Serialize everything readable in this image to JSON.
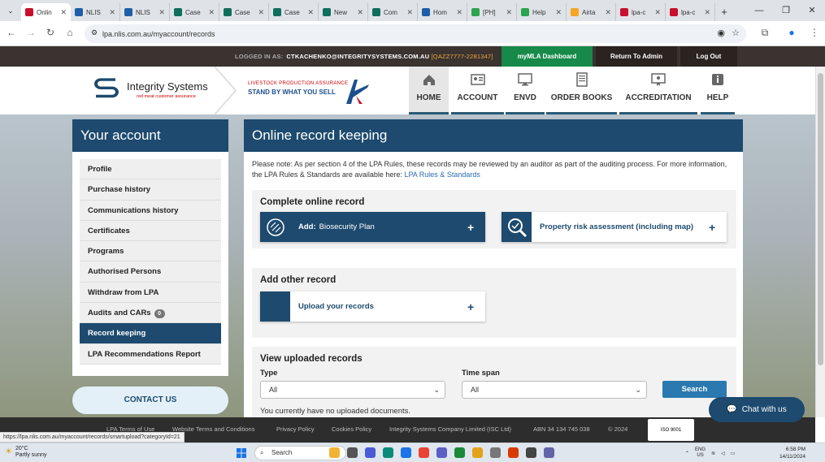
{
  "browser": {
    "tabs": [
      {
        "title": "Onlin",
        "color": "#c8102e",
        "active": true
      },
      {
        "title": "NLIS",
        "color": "#1f5fa8"
      },
      {
        "title": "NLIS",
        "color": "#1f5fa8"
      },
      {
        "title": "Case",
        "color": "#0f6f5c"
      },
      {
        "title": "Case",
        "color": "#0f6f5c"
      },
      {
        "title": "Case",
        "color": "#0f6f5c"
      },
      {
        "title": "New",
        "color": "#0f6f5c"
      },
      {
        "title": "Com",
        "color": "#0f6f5c"
      },
      {
        "title": "Hom",
        "color": "#1f5fa8"
      },
      {
        "title": "[PH]",
        "color": "#2da44e"
      },
      {
        "title": "Help",
        "color": "#2da44e"
      },
      {
        "title": "Airta",
        "color": "#f5a623"
      },
      {
        "title": "lpa-c",
        "color": "#c8102e"
      },
      {
        "title": "lpa-c",
        "color": "#c8102e"
      }
    ],
    "new_tab": "+",
    "url": "lpa.nlis.com.au/myaccount/records",
    "window_controls": [
      "—",
      "❐",
      "✕"
    ]
  },
  "topbar": {
    "logged_in_label": "LOGGED IN AS:",
    "user": "CTKACHENKO@INTEGRITYSYSTEMS.COM.AU",
    "account": "[QAZZ7777-2281347]",
    "mymla": "myMLA Dashboard",
    "return_admin": "Return To Admin",
    "logout": "Log Out",
    "mymla_color": "#178a4a"
  },
  "header": {
    "logo_name": "Integrity Systems",
    "logo_sub": "red meat customer assurance",
    "lpa_line1": "LIVESTOCK PRODUCTION ASSURANCE",
    "lpa_line2": "STAND BY WHAT YOU SELL",
    "nav": [
      {
        "label": "HOME",
        "icon": "home-icon"
      },
      {
        "label": "ACCOUNT",
        "icon": "id-card-icon"
      },
      {
        "label": "ENVD",
        "icon": "monitor-icon"
      },
      {
        "label": "ORDER BOOKS",
        "icon": "book-icon"
      },
      {
        "label": "ACCREDITATION",
        "icon": "certificate-icon"
      },
      {
        "label": "HELP",
        "icon": "info-icon"
      }
    ]
  },
  "sidebar": {
    "title": "Your account",
    "items": [
      {
        "label": "Profile"
      },
      {
        "label": "Purchase history"
      },
      {
        "label": "Communications history"
      },
      {
        "label": "Certificates"
      },
      {
        "label": "Programs"
      },
      {
        "label": "Authorised Persons"
      },
      {
        "label": "Withdraw from LPA"
      },
      {
        "label": "Audits and CARs",
        "badge": "0"
      },
      {
        "label": "Record keeping",
        "active": true
      },
      {
        "label": "LPA Recommendations Report"
      }
    ],
    "contact": "CONTACT US"
  },
  "main": {
    "title": "Online record keeping",
    "note": "Please note: As per section 4 of the LPA Rules, these records may be reviewed by an auditor as part of the auditing process. For more information, the LPA Rules & Standards are available here: ",
    "note_link": "LPA Rules & Standards",
    "complete_title": "Complete online record",
    "add_prefix": "Add:",
    "add_label": "Biosecurity Plan",
    "risk_label": "Property risk assessment (including map)",
    "plus": "+",
    "other_title": "Add other record",
    "upload_label": "Upload your records",
    "view_title": "View uploaded records",
    "type_label": "Type",
    "type_value": "All",
    "timespan_label": "Time span",
    "timespan_value": "All",
    "search": "Search",
    "no_docs": "You currently have no uploaded documents."
  },
  "footer": {
    "links": [
      "LPA Terms of Use",
      "Website Terms and Conditions",
      "Privacy Policy",
      "Cookies Policy",
      "Integrity Systems Company Limited (ISC Ltd)",
      "ABN 34 134 745 038",
      "© 2024"
    ],
    "cert": "ISO 9001"
  },
  "chat": "Chat with us",
  "status_url": "https://lpa.nlis.com.au/myaccount/records/smartupload?categoryId=21",
  "taskbar": {
    "temp": "20°C",
    "weather": "Partly sunny",
    "search": "Search",
    "lang": "ENG",
    "region": "US",
    "time": "6:58 PM",
    "date": "14/11/2024"
  }
}
